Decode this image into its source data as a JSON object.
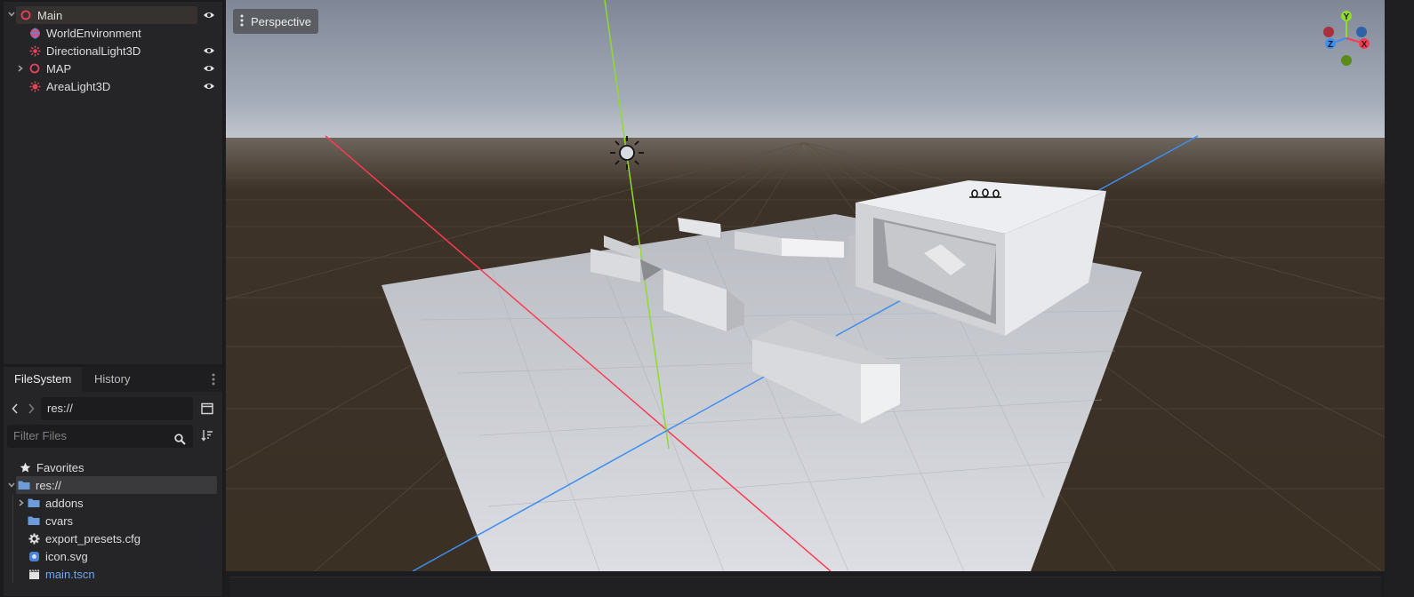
{
  "scene_tree": {
    "items": [
      {
        "label": "Main",
        "icon": "node3d-icon"
      },
      {
        "label": "WorldEnvironment",
        "icon": "world-environment-icon"
      },
      {
        "label": "DirectionalLight3D",
        "icon": "directional-light-icon"
      },
      {
        "label": "MAP",
        "icon": "node3d-icon"
      },
      {
        "label": "AreaLight3D",
        "icon": "light-icon"
      }
    ]
  },
  "filesystem": {
    "tabs": [
      "FileSystem",
      "History"
    ],
    "path": "res://",
    "filter_placeholder": "Filter Files",
    "items": [
      {
        "label": "Favorites",
        "icon": "star-icon"
      },
      {
        "label": "res://",
        "icon": "folder-icon"
      },
      {
        "label": "addons",
        "icon": "folder-icon"
      },
      {
        "label": "cvars",
        "icon": "folder-icon"
      },
      {
        "label": "export_presets.cfg",
        "icon": "gear-file-icon"
      },
      {
        "label": "icon.svg",
        "icon": "svg-file-icon"
      },
      {
        "label": "main.tscn",
        "icon": "scene-file-icon"
      }
    ]
  },
  "viewport": {
    "view_mode": "Perspective",
    "gizmo_axes": [
      "Y",
      "X",
      "Z"
    ]
  },
  "colors": {
    "accent_red": "#e0455a",
    "x_axis": "#ff3a52",
    "y_axis": "#8fdb2a",
    "z_axis": "#3d8ef0",
    "link_blue": "#71a6ea"
  }
}
